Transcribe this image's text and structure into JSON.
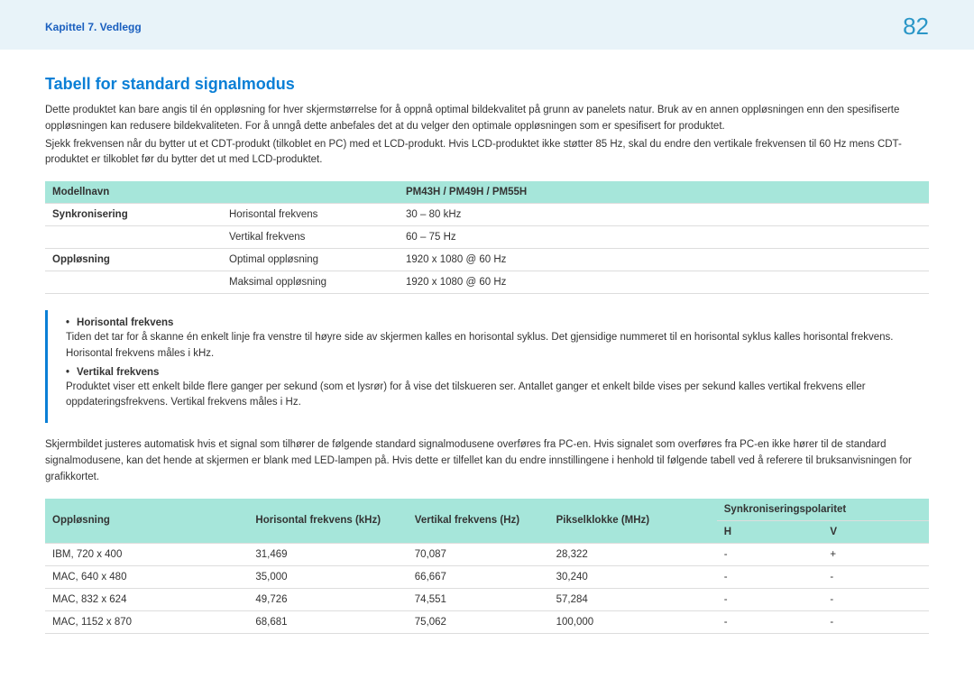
{
  "header": {
    "chapter": "Kapittel 7. Vedlegg",
    "page_number": "82"
  },
  "section_title": "Tabell for standard signalmodus",
  "intro_p1": "Dette produktet kan bare angis til én oppløsning for hver skjermstørrelse for å oppnå optimal bildekvalitet på grunn av panelets natur. Bruk av en annen oppløsningen enn den spesifiserte oppløsningen kan redusere bildekvaliteten. For å unngå dette anbefales det at du velger den optimale oppløsningen som er spesifisert for produktet.",
  "intro_p2": "Sjekk frekvensen når du bytter ut et CDT-produkt (tilkoblet en PC) med et LCD-produkt. Hvis LCD-produktet ikke støtter 85 Hz, skal du endre den vertikale frekvensen til 60 Hz mens CDT-produktet er tilkoblet før du bytter det ut med LCD-produktet.",
  "table1": {
    "header": {
      "col1": "Modellnavn",
      "col2": "PM43H / PM49H / PM55H"
    },
    "rows": [
      {
        "cat": "Synkronisering",
        "label": "Horisontal frekvens",
        "value": "30 – 80 kHz"
      },
      {
        "cat": "",
        "label": "Vertikal frekvens",
        "value": "60 – 75 Hz"
      },
      {
        "cat": "Oppløsning",
        "label": "Optimal oppløsning",
        "value": "1920 x 1080 @ 60 Hz"
      },
      {
        "cat": "",
        "label": "Maksimal oppløsning",
        "value": "1920 x 1080 @ 60 Hz"
      }
    ]
  },
  "notes": {
    "hf_title": "Horisontal frekvens",
    "hf_desc": "Tiden det tar for å skanne én enkelt linje fra venstre til høyre side av skjermen kalles en horisontal syklus. Det gjensidige nummeret til en horisontal syklus kalles horisontal frekvens. Horisontal frekvens måles i kHz.",
    "vf_title": "Vertikal frekvens",
    "vf_desc": "Produktet viser ett enkelt bilde flere ganger per sekund (som et lysrør) for å vise det tilskueren ser. Antallet ganger et enkelt bilde vises per sekund kalles vertikal frekvens eller oppdateringsfrekvens. Vertikal frekvens måles i Hz."
  },
  "mid_p": "Skjermbildet justeres automatisk hvis et signal som tilhører de følgende standard signalmodusene overføres fra PC-en. Hvis signalet som overføres fra PC-en ikke hører til de standard signalmodusene, kan det hende at skjermen er blank med LED-lampen på. Hvis dette er tilfellet kan du endre innstillingene i henhold til følgende tabell ved å referere til bruksanvisningen for grafikkortet.",
  "table2": {
    "header": {
      "res": "Oppløsning",
      "hf": "Horisontal frekvens (kHz)",
      "vf": "Vertikal frekvens (Hz)",
      "pc": "Pikselklokke (MHz)",
      "sync": "Synkroniseringspolaritet",
      "h": "H",
      "v": "V"
    },
    "rows": [
      {
        "res": "IBM, 720 x 400",
        "hf": "31,469",
        "vf": "70,087",
        "pc": "28,322",
        "h": "-",
        "v": "+"
      },
      {
        "res": "MAC, 640 x 480",
        "hf": "35,000",
        "vf": "66,667",
        "pc": "30,240",
        "h": "-",
        "v": "-"
      },
      {
        "res": "MAC, 832 x 624",
        "hf": "49,726",
        "vf": "74,551",
        "pc": "57,284",
        "h": "-",
        "v": "-"
      },
      {
        "res": "MAC, 1152 x 870",
        "hf": "68,681",
        "vf": "75,062",
        "pc": "100,000",
        "h": "-",
        "v": "-"
      }
    ]
  }
}
